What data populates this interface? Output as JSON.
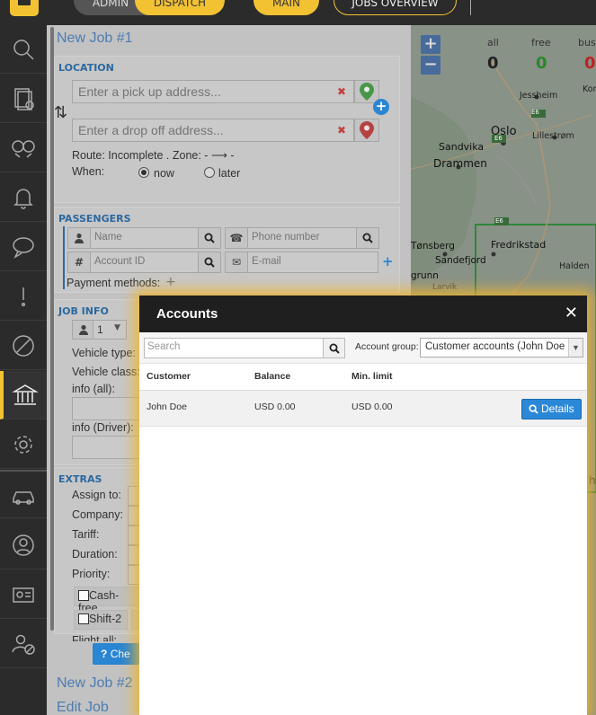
{
  "topbar": {
    "admin_label": "ADMIN",
    "dispatch_label": "DISPATCH",
    "main_label": "MAIN",
    "jobs_overview_label": "JOBS OVERVIEW"
  },
  "sidebar": {
    "items": [
      {
        "icon": "search-icon"
      },
      {
        "icon": "document-check-icon"
      },
      {
        "icon": "handshake-icon"
      },
      {
        "icon": "bell-icon"
      },
      {
        "icon": "chat-icon"
      },
      {
        "icon": "exclamation-icon"
      },
      {
        "icon": "forbidden-icon"
      },
      {
        "icon": "bank-icon",
        "active": true
      },
      {
        "icon": "gear-icon"
      },
      {
        "icon": "car-icon"
      },
      {
        "icon": "user-circle-icon"
      },
      {
        "icon": "id-card-icon"
      },
      {
        "icon": "user-blocked-icon"
      }
    ]
  },
  "job_form": {
    "title": "New Job #1",
    "location": {
      "section_title": "LOCATION",
      "pickup_placeholder": "Enter a pick up address...",
      "dropoff_placeholder": "Enter a drop off address...",
      "route_text": "Route: Incomplete . Zone: - ⟶ -",
      "when_label": "When:",
      "now_label": "now",
      "later_label": "later",
      "selected": "now"
    },
    "passengers": {
      "section_title": "PASSENGERS",
      "name_placeholder": "Name",
      "phone_placeholder": "Phone number",
      "account_placeholder": "Account ID",
      "email_placeholder": "E-mail",
      "payment_methods_label": "Payment methods:"
    },
    "job_info": {
      "section_title": "JOB INFO",
      "count_value": "1",
      "vehicle_type_label": "Vehicle type:",
      "vehicle_class_label": "Vehicle class:",
      "info_all_label": "info (all):",
      "info_driver_label": "info (Driver):"
    },
    "extras": {
      "section_title": "EXTRAS",
      "assign_to_label": "Assign to:",
      "company_label": "Company:",
      "tariff_label": "Tariff:",
      "duration_label": "Duration:",
      "priority_label": "Priority:",
      "cash_free_label": "Cash-free",
      "shift2_label": "Shift-2",
      "flight_label": "Flight all:",
      "check_button_label": "Che"
    },
    "other_jobs": [
      "New Job #2",
      "Edit Job"
    ]
  },
  "map": {
    "stats": {
      "all_label": "all",
      "all_value": "0",
      "free_label": "free",
      "free_value": "0",
      "busy_label": "bus",
      "busy_value": "0"
    },
    "places": [
      "Jessheim",
      "Kon",
      "Oslo",
      "Lillestrøm",
      "Sandvika",
      "Drammen",
      "Fredrikstad",
      "Halden",
      "Tønsberg",
      "Sandefjord",
      "grunn",
      "Larvik"
    ],
    "road_labels": [
      "E6",
      "E6",
      "E6"
    ],
    "edge_labels": [
      "h"
    ]
  },
  "modal": {
    "title": "Accounts",
    "close_label": "✕",
    "search_placeholder": "Search",
    "account_group_label": "Account group:",
    "account_group_value": "Customer accounts (John Doe Ltd)",
    "columns": [
      "Customer",
      "Balance",
      "Min. limit"
    ],
    "rows": [
      {
        "customer": "John Doe",
        "balance": "USD 0.00",
        "min_limit": "USD 0.00",
        "action_label": "Details"
      }
    ]
  },
  "colors": {
    "accent": "#f2c233",
    "primary_blue": "#2b88d7",
    "sidebar_bg": "#2b2b2b",
    "free_green": "#2a8a2a",
    "busy_red": "#c22222"
  }
}
